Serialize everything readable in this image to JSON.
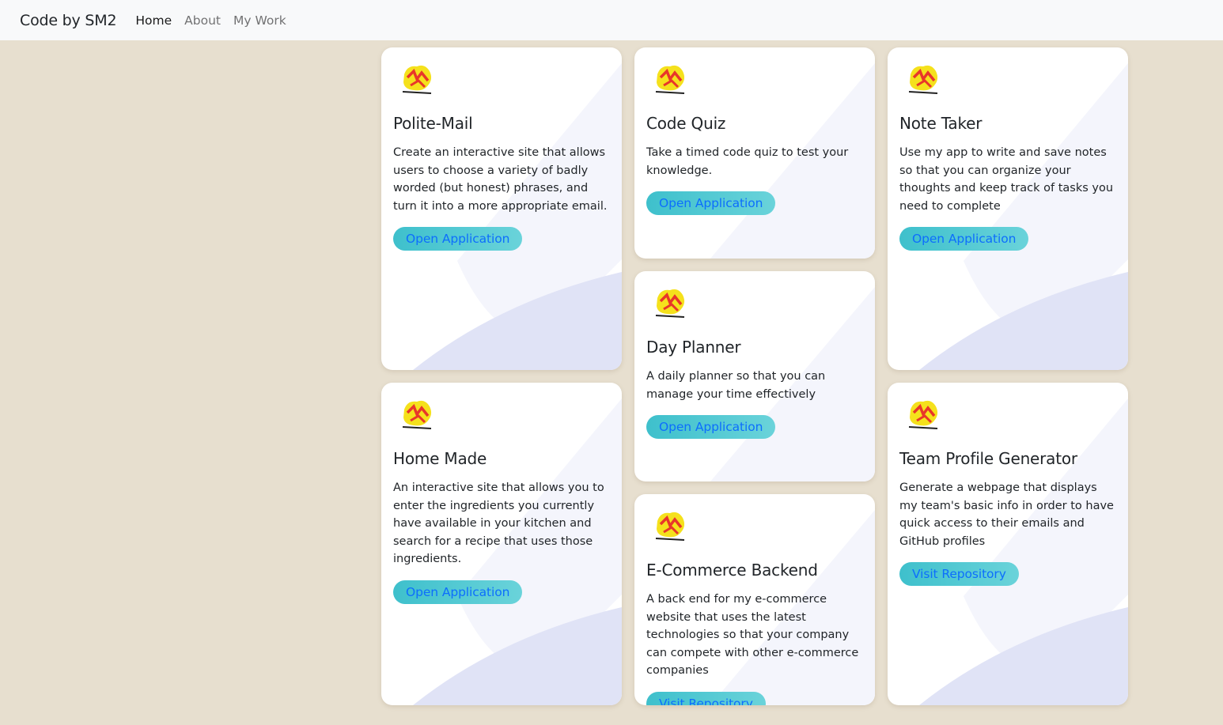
{
  "navbar": {
    "brand": "Code by SM2",
    "links": [
      "Home",
      "About",
      "My Work"
    ]
  },
  "colors": {
    "page_background": "#e7dfcf",
    "navbar_background": "#f8f9fa",
    "button_gradient_start": "#3ec0cc",
    "button_gradient_end": "#6ad3da",
    "button_text": "#0d6efd",
    "logo_yellow": "#f5e11c",
    "logo_red": "#e8362a"
  },
  "cards": [
    {
      "title": "Polite-Mail",
      "text": "Create an interactive site that allows users to choose a variety of badly worded (but honest) phrases, and turn it into a more appropriate email.",
      "button": "Open Application"
    },
    {
      "title": "Code Quiz",
      "text": "Take a timed code quiz to test your knowledge.",
      "button": "Open Application"
    },
    {
      "title": "Note Taker",
      "text": "Use my app to write and save notes so that you can organize your thoughts and keep track of tasks you need to complete",
      "button": "Open Application"
    },
    {
      "title": "Day Planner",
      "text": "A daily planner so that you can manage your time effectively",
      "button": "Open Application"
    },
    {
      "title": "Home Made",
      "text": "An interactive site that allows you to enter the ingredients you currently have available in your kitchen and search for a recipe that uses those ingredients.",
      "button": "Open Application"
    },
    {
      "title": "Team Profile Generator",
      "text": "Generate a webpage that displays my team's basic info in order to have quick access to their emails and GitHub profiles",
      "button": "Visit Repository"
    },
    {
      "title": "E-Commerce Backend",
      "text": "A back end for my e-commerce website that uses the latest technologies so that your company can compete with other e-commerce companies",
      "button": "Visit Repository"
    }
  ]
}
